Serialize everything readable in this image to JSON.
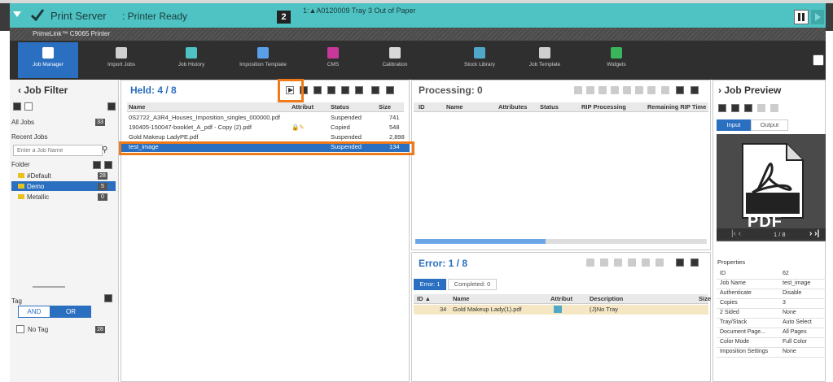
{
  "topbar": {
    "server_label": "Print Server",
    "status_label": ": Printer Ready",
    "job_count": "2",
    "warning": "1:▲A0120009 Tray 3 Out of Paper",
    "printer_name": "PrimeLink™ C9065 Printer"
  },
  "ribbon": [
    {
      "label": "Job Manager",
      "color": "#ffffff",
      "active": true
    },
    {
      "label": "Import Jobs",
      "color": "#d0d0d0"
    },
    {
      "label": "Job History",
      "color": "#4fc3c3"
    },
    {
      "label": "Imposition Template",
      "color": "#5aa0e8"
    },
    {
      "label": "CMS",
      "color": "#c8389a"
    },
    {
      "label": "Calibration",
      "color": "#d8d8d8"
    },
    {
      "label": "Stock Library",
      "color": "#4fa8c8"
    },
    {
      "label": "Job Template",
      "color": "#d0d0d0"
    },
    {
      "label": "Widgets",
      "color": "#3bb55b"
    }
  ],
  "job_filter": {
    "title": "Job Filter",
    "all_jobs_label": "All Jobs",
    "all_jobs_count": "33",
    "recent_jobs_label": "Recent Jobs",
    "search_placeholder": "Enter a Job Name",
    "folder_label": "Folder",
    "folders": [
      {
        "name": "#Default",
        "count": "28",
        "selected": false
      },
      {
        "name": "Demo",
        "count": "5",
        "selected": true
      },
      {
        "name": "Metallic",
        "count": "0",
        "selected": false
      }
    ],
    "tag_label": "Tag",
    "and_label": "AND",
    "or_label": "OR",
    "no_tag_label": "No Tag",
    "no_tag_count": "28"
  },
  "held": {
    "title": "Held: 4 / 8",
    "columns": [
      "Name",
      "Attribut",
      "Status",
      "Size"
    ],
    "rows": [
      {
        "name": "0S2722_A3R4_Houses_Imposition_singles_000000.pdf",
        "status": "Suspended",
        "size": "741"
      },
      {
        "name": "190405-150047-booklet_A_pdf - Copy (2).pdf",
        "status": "Copied",
        "size": "548"
      },
      {
        "name": "Gold Makeup LadyPE.pdf",
        "status": "Suspended",
        "size": "2,898"
      },
      {
        "name": "test_image",
        "status": "Suspended",
        "size": "134",
        "selected": true
      }
    ]
  },
  "processing": {
    "title": "Processing: 0",
    "columns": [
      "ID",
      "Name",
      "Attributes",
      "Status",
      "RIP Processing",
      "Remaining RIP Time"
    ]
  },
  "error": {
    "title": "Error: 1 / 8",
    "tab_error": "Error: 1",
    "tab_completed": "Completed: 0",
    "columns": [
      "ID ▲",
      "Name",
      "Attribut",
      "Description",
      "Size"
    ],
    "rows": [
      {
        "id": "34",
        "name": "Gold Makeup Lady(1).pdf",
        "description": "(J)No Tray"
      }
    ]
  },
  "preview": {
    "title": "Job Preview",
    "tab_input": "Input",
    "tab_output": "Output",
    "pdf_label": "PDF",
    "page": "1 / 8",
    "properties_label": "Properties",
    "properties": [
      [
        "ID",
        "62"
      ],
      [
        "Job Name",
        "test_image"
      ],
      [
        "Authenticate",
        "Disable"
      ],
      [
        "Copies",
        "3"
      ],
      [
        "2 Sided",
        "None"
      ],
      [
        "Tray/Stack",
        "Auto Select"
      ],
      [
        "Document Page...",
        "All Pages"
      ],
      [
        "Color Mode",
        "Full Color"
      ],
      [
        "Imposition Settings",
        "None"
      ]
    ]
  }
}
